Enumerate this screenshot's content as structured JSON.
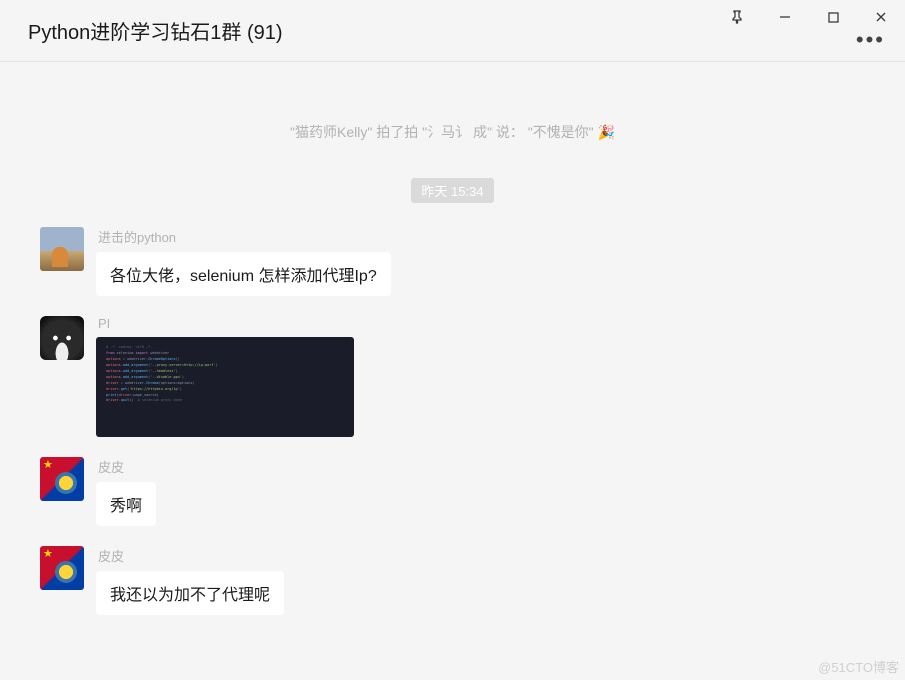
{
  "header": {
    "title": "Python进阶学习钻石1群 (91)"
  },
  "system_message": "\"猫药师Kelly\" 拍了拍 \"氵马讠 成\" 说：  \"不愧是你\" 🎉",
  "timestamp": "昨天 15:34",
  "messages": [
    {
      "sender": "进击的python",
      "avatar_kind": "street",
      "type": "text",
      "text": "各位大佬，selenium 怎样添加代理Ip?"
    },
    {
      "sender": "PI",
      "avatar_kind": "face",
      "type": "image",
      "alt": "code screenshot"
    },
    {
      "sender": "皮皮",
      "avatar_kind": "py",
      "type": "text",
      "text": "秀啊"
    },
    {
      "sender": "皮皮",
      "avatar_kind": "py",
      "type": "text",
      "text": "我还以为加不了代理呢"
    }
  ],
  "watermark": "@51CTO博客"
}
